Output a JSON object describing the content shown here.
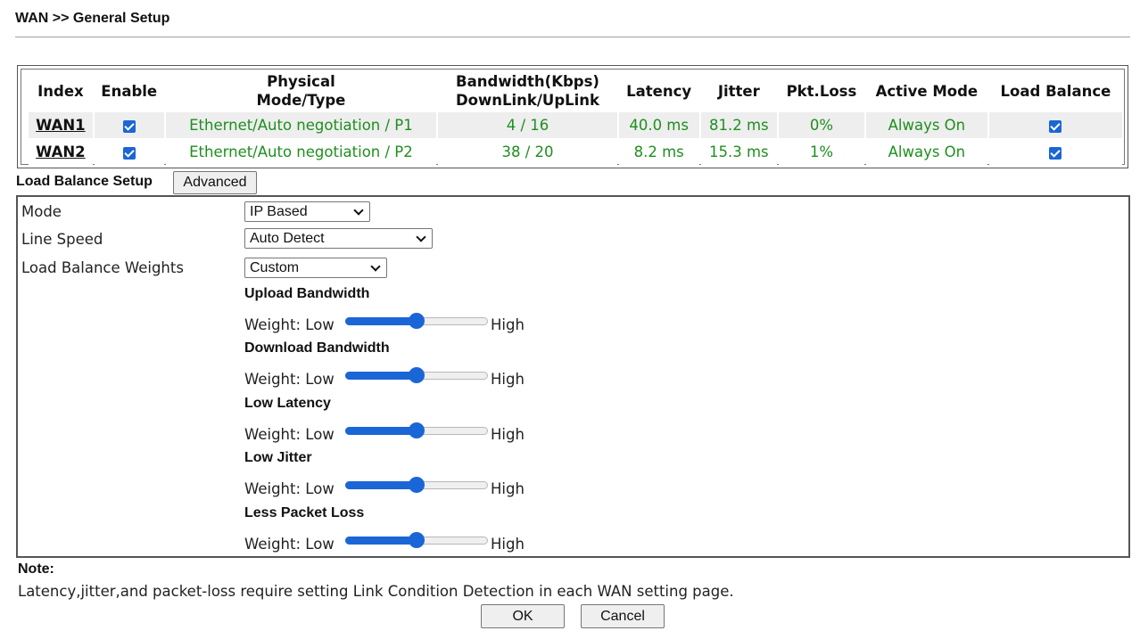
{
  "page": {
    "title": "WAN >> General Setup"
  },
  "wan_table": {
    "headers": {
      "index": "Index",
      "enable": "Enable",
      "physical_1": "Physical",
      "physical_2": "Mode/Type",
      "bandwidth_1": "Bandwidth(Kbps)",
      "bandwidth_2": "DownLink/UpLink",
      "latency": "Latency",
      "jitter": "Jitter",
      "pktloss": "Pkt.Loss",
      "active_mode": "Active Mode",
      "load_balance": "Load Balance"
    },
    "rows": [
      {
        "index": "WAN1",
        "enable": true,
        "mode": "Ethernet/Auto negotiation / P1",
        "bandwidth": "4 / 16",
        "latency": "40.0 ms",
        "jitter": "81.2 ms",
        "pktloss": "0%",
        "active_mode": "Always On",
        "load_balance": true
      },
      {
        "index": "WAN2",
        "enable": true,
        "mode": "Ethernet/Auto negotiation / P2",
        "bandwidth": "38 / 20",
        "latency": "8.2 ms",
        "jitter": "15.3 ms",
        "pktloss": "1%",
        "active_mode": "Always On",
        "load_balance": true
      }
    ]
  },
  "load_balance": {
    "title": "Load Balance Setup",
    "advanced_button": "Advanced",
    "mode": {
      "label": "Mode",
      "value": "IP Based"
    },
    "line_speed": {
      "label": "Line Speed",
      "value": "Auto Detect"
    },
    "weights": {
      "label": "Load Balance Weights",
      "value": "Custom"
    },
    "weight_prefix": "Weight: Low",
    "weight_suffix": "High",
    "sliders": [
      {
        "name": "Upload Bandwidth",
        "value_pct": 50
      },
      {
        "name": "Download Bandwidth",
        "value_pct": 50
      },
      {
        "name": "Low Latency",
        "value_pct": 50
      },
      {
        "name": "Low Jitter",
        "value_pct": 50
      },
      {
        "name": "Less Packet Loss",
        "value_pct": 50
      }
    ]
  },
  "note": {
    "title": "Note:",
    "text": "Latency,jitter,and packet-loss require setting Link Condition Detection in each WAN setting page."
  },
  "buttons": {
    "ok": "OK",
    "cancel": "Cancel"
  },
  "colors": {
    "accent": "#1a66d6",
    "status_green": "#1e8f1e"
  }
}
